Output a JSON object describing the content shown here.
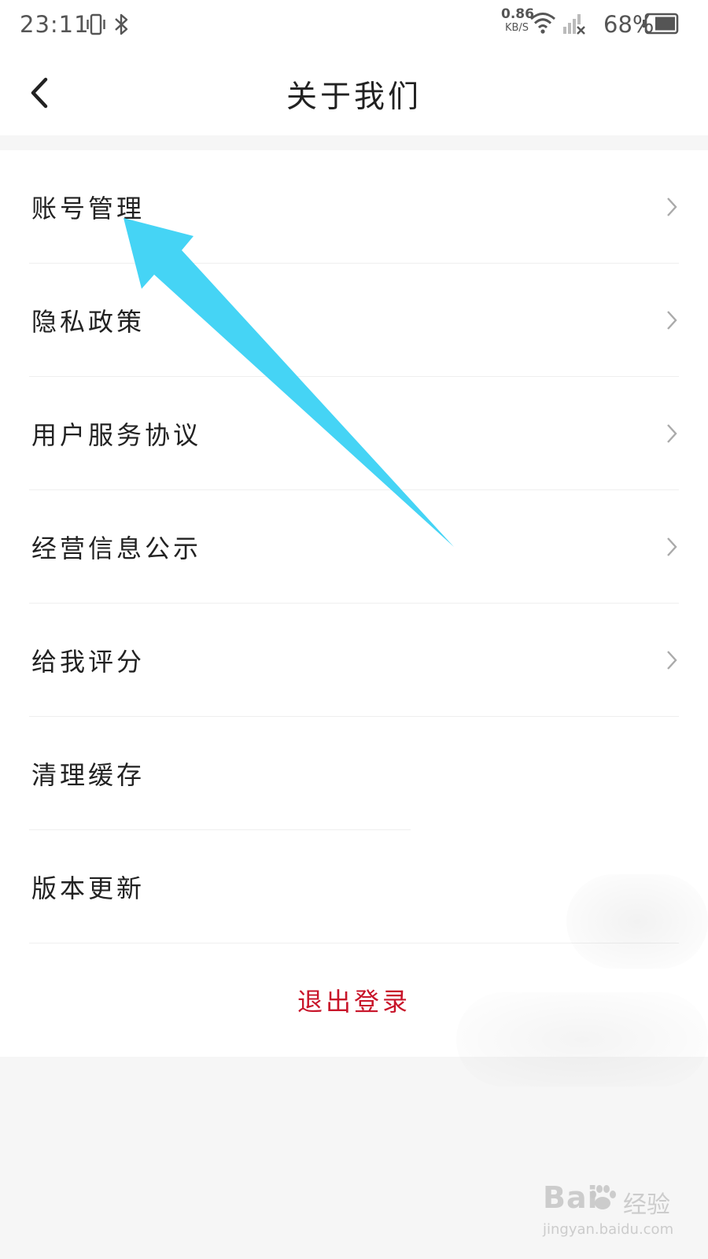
{
  "status_bar": {
    "time": "23:11",
    "net_speed_value": "0.86",
    "net_speed_unit": "KB/S",
    "battery_percent": "68%",
    "icons": [
      "vibrate-icon",
      "bluetooth-icon",
      "wifi-icon",
      "no-signal-icon",
      "battery-icon"
    ]
  },
  "header": {
    "title": "关于我们",
    "back_icon": "chevron-left-icon"
  },
  "menu": {
    "items": [
      {
        "label": "账号管理",
        "chevron": true
      },
      {
        "label": "隐私政策",
        "chevron": true
      },
      {
        "label": "用户服务协议",
        "chevron": true
      },
      {
        "label": "经营信息公示",
        "chevron": true
      },
      {
        "label": "给我评分",
        "chevron": true
      },
      {
        "label": "清理缓存",
        "chevron": false
      },
      {
        "label": "版本更新",
        "chevron": false
      }
    ],
    "logout_label": "退出登录"
  },
  "annotation": {
    "arrow_color": "#45d4f5",
    "points_to": "账号管理"
  },
  "watermark": {
    "brand_prefix": "Bai",
    "brand_suffix": "经验",
    "url": "jingyan.baidu.com"
  },
  "colors": {
    "logout_text": "#c8152a",
    "page_background": "#f6f6f6",
    "list_background": "#ffffff",
    "arrow": "#45d4f5"
  }
}
